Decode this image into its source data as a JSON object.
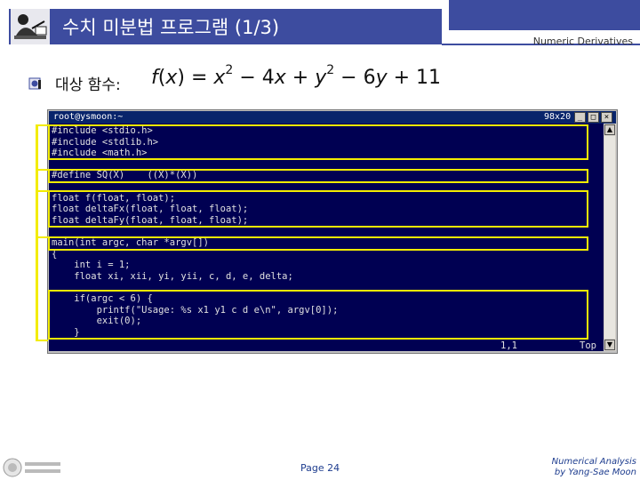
{
  "header": {
    "title": "수치 미분법 프로그램 (1/3)",
    "subtitle": "Numeric Derivatives"
  },
  "bullet": {
    "label": "대상 함수:",
    "formula": {
      "lhs": "f",
      "var": "x",
      "eq": " = ",
      "t1": "x",
      "p1": "2",
      "t2": " − 4",
      "t3": "x",
      "t4": " + ",
      "t5": "y",
      "p2": "2",
      "t6": " − 6",
      "t7": "y",
      "t8": " + 11"
    }
  },
  "terminal": {
    "title": "root@ysmoon:~",
    "size": "98x20",
    "buttons": {
      "minimize": "_",
      "maximize": "□",
      "close": "×"
    },
    "lines": [
      "#include <stdio.h>",
      "#include <stdlib.h>",
      "#include <math.h>",
      "",
      "#define SQ(X)    ((X)*(X))",
      "",
      "float f(float, float);",
      "float deltaFx(float, float, float);",
      "float deltaFy(float, float, float);",
      "",
      "main(int argc, char *argv[])",
      "{",
      "    int i = 1;",
      "    float xi, xii, yi, yii, c, d, e, delta;",
      "",
      "    if(argc < 6) {",
      "        printf(\"Usage: %s x1 y1 c d e\\n\", argv[0]);",
      "        exit(0);",
      "    }"
    ],
    "status_pos": "1,1",
    "status_top": "Top"
  },
  "footer": {
    "page": "Page 24",
    "course": "Numerical Analysis",
    "author": "by Yang-Sae Moon"
  }
}
